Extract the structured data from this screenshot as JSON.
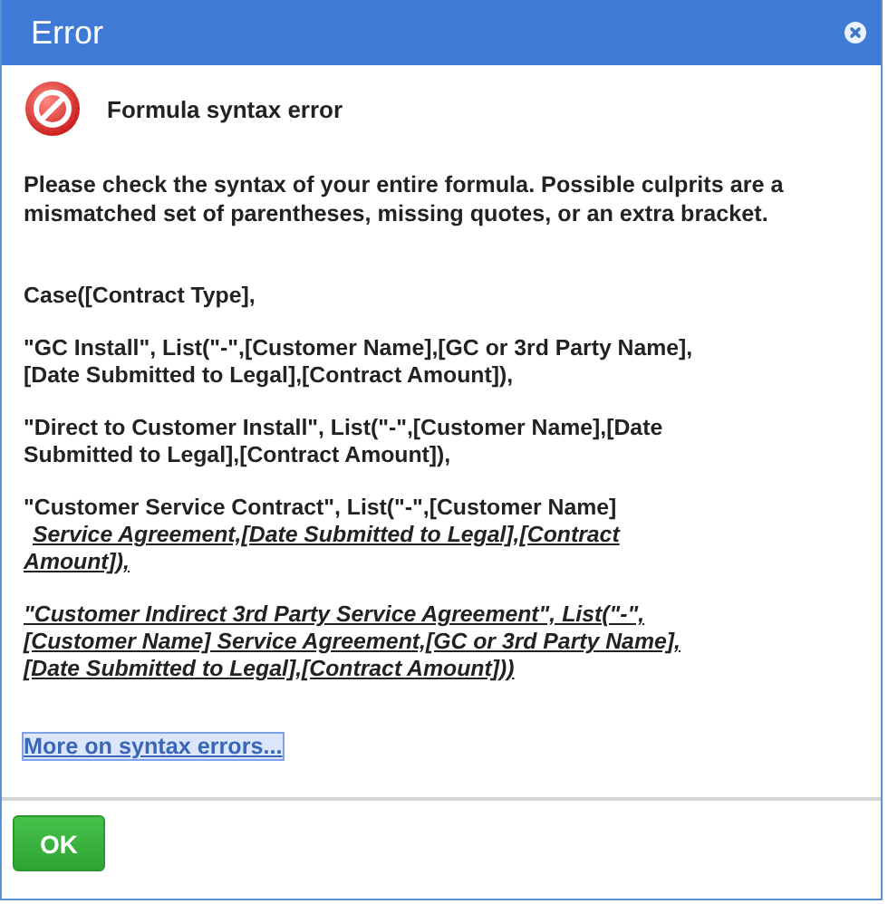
{
  "window": {
    "title": "Error"
  },
  "heading": "Formula syntax error",
  "message": "Please check the syntax of your entire formula. Possible culprits are a mismatched set of parentheses, missing quotes, or an extra bracket.",
  "formula": [
    {
      "segments": [
        {
          "text": "Case([Contract Type],",
          "kind": "plain"
        }
      ]
    },
    {
      "segments": [
        {
          "text": "\"GC Install\", List(\"-\",[Customer Name],[GC or 3rd Party Name],[Date Submitted to Legal],[Contract Amount]),",
          "kind": "plain"
        }
      ]
    },
    {
      "segments": [
        {
          "text": "\"Direct to Customer Install\", List(\"-\",[Customer Name],[Date Submitted to Legal],[Contract Amount]),",
          "kind": "plain"
        }
      ]
    },
    {
      "segments": [
        {
          "text": "\"Customer Service Contract\", List(\"-\",[Customer Name]",
          "kind": "plain"
        },
        {
          "text": "Service Agreement,[Date Submitted to Legal],[Contract Amount]),",
          "kind": "emphasis",
          "new_line": true
        }
      ]
    },
    {
      "segments": [
        {
          "text": "\"Customer Indirect 3rd Party Service Agreement\", List(\"-\",[Customer Name] Service Agreement,[GC or 3rd Party Name],[Date Submitted to Legal],[Contract Amount]))",
          "kind": "emphasis"
        }
      ]
    }
  ],
  "link": {
    "label": "More on syntax errors...",
    "focused": true
  },
  "buttons": [
    {
      "label": "OK",
      "kind": "primary"
    }
  ]
}
